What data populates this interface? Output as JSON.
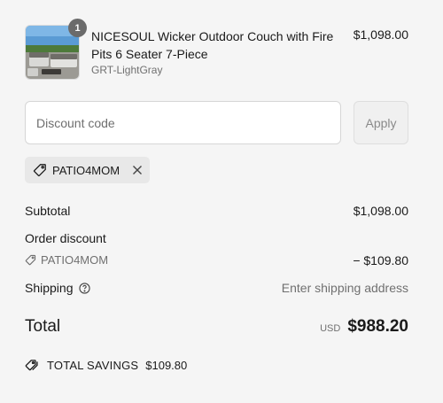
{
  "product": {
    "quantity": "1",
    "name": "NICESOUL Wicker Outdoor Couch with Fire Pits 6 Seater 7-Piece",
    "variant": "GRT-LightGray",
    "price": "$1,098.00"
  },
  "discount": {
    "placeholder": "Discount code",
    "apply_label": "Apply",
    "applied_code": "PATIO4MOM"
  },
  "summary": {
    "subtotal_label": "Subtotal",
    "subtotal_value": "$1,098.00",
    "order_discount_label": "Order discount",
    "discount_code": "PATIO4MOM",
    "discount_value": "− $109.80",
    "shipping_label": "Shipping",
    "shipping_value": "Enter shipping address",
    "total_label": "Total",
    "currency": "USD",
    "total_value": "$988.20",
    "savings_label": "TOTAL SAVINGS",
    "savings_value": "$109.80"
  },
  "colors": {
    "background": "#f5f5f5",
    "text": "#1a1a1a",
    "muted": "#707070",
    "badge": "#6b6b6b"
  },
  "icons": [
    "tag-icon",
    "close-icon",
    "help-circle-icon",
    "savings-tags-icon"
  ]
}
